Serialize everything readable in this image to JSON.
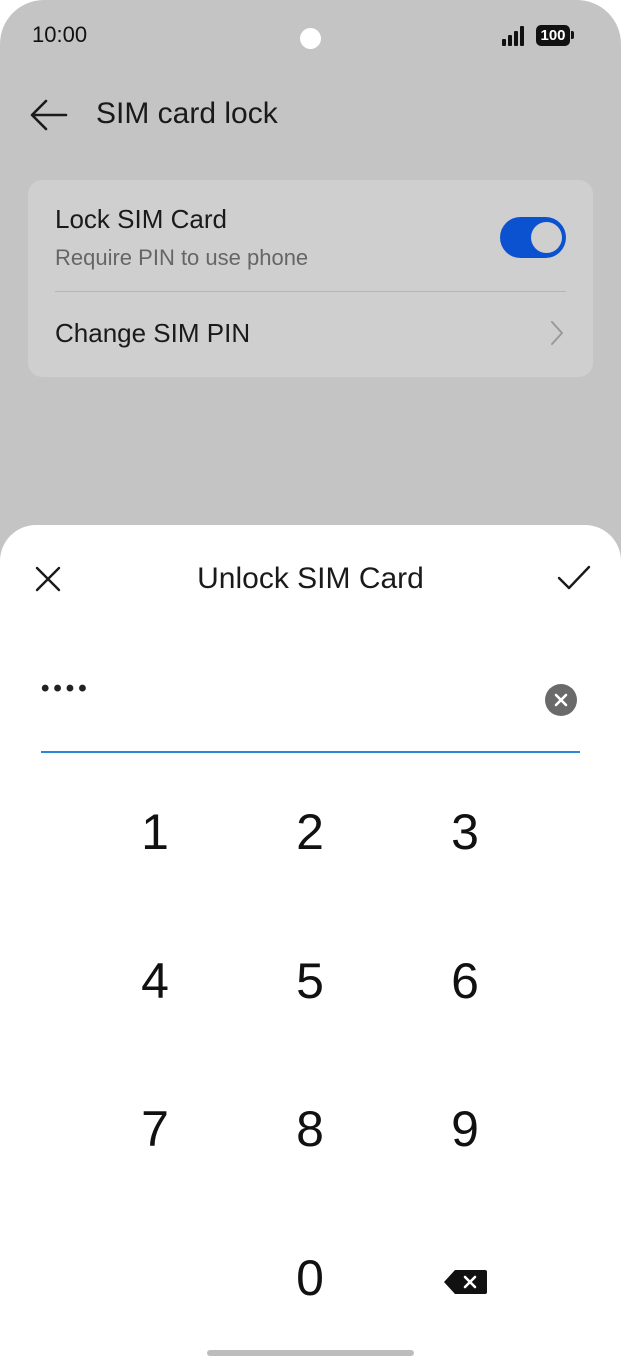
{
  "status_bar": {
    "time": "10:00",
    "battery": "100",
    "signal_icon": "cellular-signal-icon"
  },
  "header": {
    "title": "SIM card lock",
    "back_icon": "back-arrow-icon"
  },
  "settings": {
    "lock_sim": {
      "title": "Lock SIM Card",
      "subtitle": "Require PIN to use phone",
      "enabled": true
    },
    "change_pin": {
      "title": "Change SIM PIN",
      "icon": "chevron-right-icon"
    }
  },
  "dialog": {
    "title": "Unlock SIM Card",
    "close_icon": "close-icon",
    "confirm_icon": "checkmark-icon",
    "pin_value": "••••",
    "clear_icon": "clear-input-icon"
  },
  "keypad": {
    "keys": [
      "1",
      "2",
      "3",
      "4",
      "5",
      "6",
      "7",
      "8",
      "9",
      "0"
    ],
    "backspace_icon": "backspace-icon"
  },
  "colors": {
    "accent": "#0b52d1",
    "input_underline": "#2c86d8",
    "scrim": "#c4c4c4"
  }
}
